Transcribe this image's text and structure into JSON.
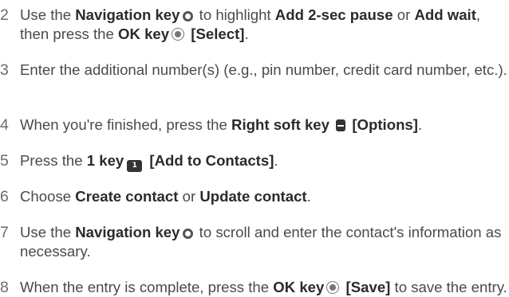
{
  "steps": [
    {
      "number": "2",
      "parts": {
        "a": "Use the ",
        "b": "Navigation key",
        "c": " to highlight ",
        "d": "Add 2-sec pause",
        "e": " or ",
        "f": "Add wait",
        "g": ", then press the ",
        "h": "OK key",
        "i": " ",
        "j": "[Select]",
        "k": "."
      }
    },
    {
      "number": "3",
      "parts": {
        "a": "Enter the additional number(s) (e.g., pin number, credit card number, etc.)."
      }
    },
    {
      "number": "4",
      "parts": {
        "a": "When you're finished, press the ",
        "b": "Right soft key",
        "c": " ",
        "d": "[Options]",
        "e": "."
      }
    },
    {
      "number": "5",
      "parts": {
        "a": "Press the ",
        "b": "1 key",
        "c": " ",
        "d": "[Add to Contacts]",
        "e": "."
      }
    },
    {
      "number": "6",
      "parts": {
        "a": "Choose ",
        "b": "Create contact",
        "c": " or ",
        "d": "Update contact",
        "e": "."
      }
    },
    {
      "number": "7",
      "parts": {
        "a": "Use the ",
        "b": "Navigation key",
        "c": " to scroll and enter the contact's information as necessary."
      }
    },
    {
      "number": "8",
      "parts": {
        "a": "When the entry is complete, press the ",
        "b": "OK key",
        "c": " ",
        "d": "[Save]",
        "e": " to save the entry."
      }
    }
  ],
  "icons": {
    "navigation_key": "navigation-key-icon",
    "ok_key": "ok-key-icon",
    "right_soft_key": "right-soft-key-icon",
    "one_key": "one-key-icon",
    "one_key_glyph": "1"
  },
  "colors": {
    "body_text": "#4a4a4a",
    "bold_text": "#2b2b2b",
    "step_number": "#6b6b6b",
    "icon": "#555555"
  }
}
